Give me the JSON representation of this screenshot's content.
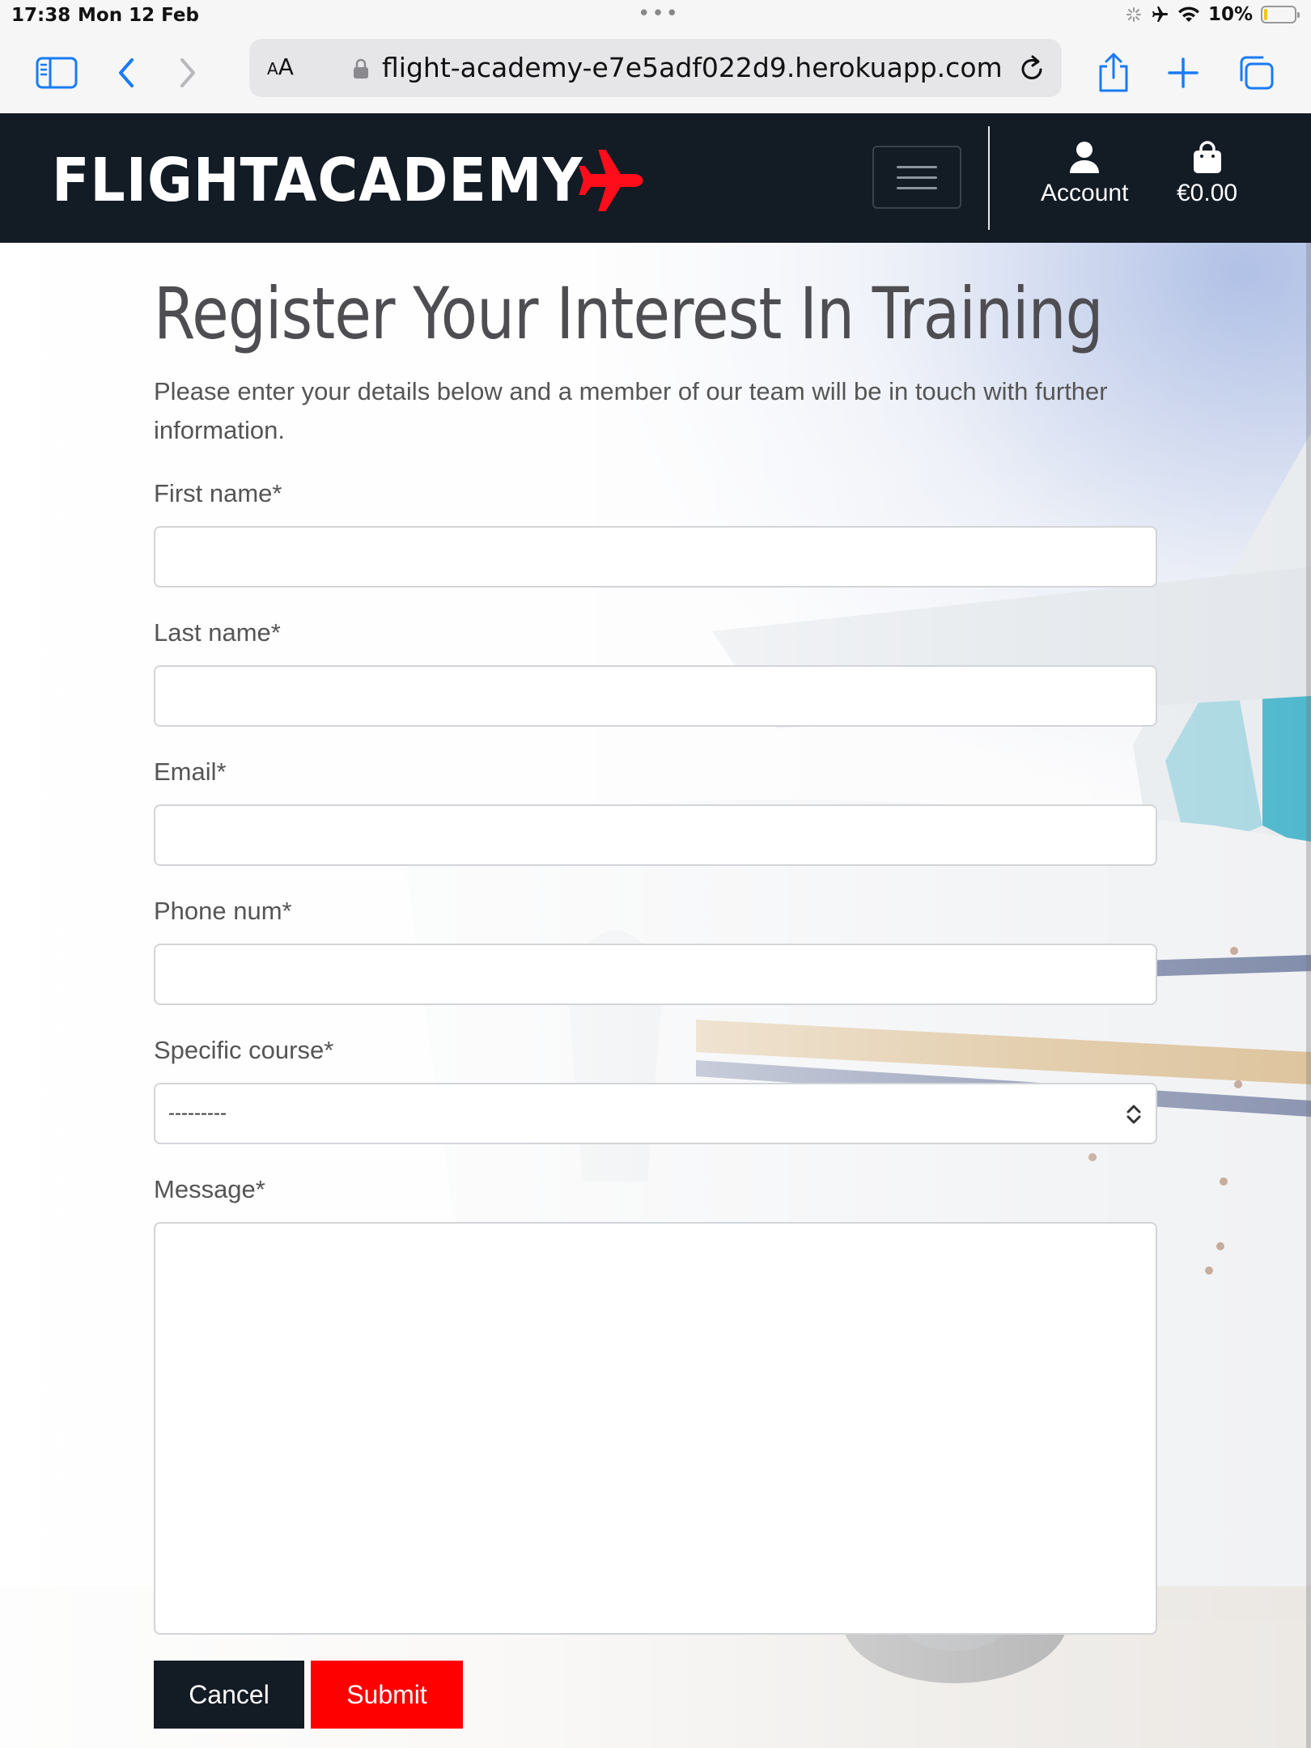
{
  "status_bar": {
    "time": "17:38",
    "date": "Mon 12 Feb",
    "battery": "10%",
    "battery_level": 0.1
  },
  "browser": {
    "text_size_label": "AA",
    "url": "flight-academy-e7e5adf022d9.herokuapp.com",
    "icons": [
      "sidebar-icon",
      "back-icon",
      "forward-icon",
      "lock-icon",
      "reload-icon",
      "share-icon",
      "new-tab-icon",
      "tabs-icon"
    ]
  },
  "header": {
    "logo_text": "FLIGHTACADEMY",
    "logo_icon": "airplane-icon",
    "account_label": "Account",
    "bag_label": "€0.00",
    "brand_color": "#131b25",
    "accent_color": "#ff0000"
  },
  "form": {
    "title": "Register Your Interest In Training",
    "intro": "Please enter your details below and a member of our team will be in touch with further information.",
    "fields": {
      "first_name": {
        "label": "First name*",
        "value": ""
      },
      "last_name": {
        "label": "Last name*",
        "value": ""
      },
      "email": {
        "label": "Email*",
        "value": ""
      },
      "phone": {
        "label": "Phone num*",
        "value": ""
      },
      "course": {
        "label": "Specific course*",
        "selected": "---------"
      },
      "message": {
        "label": "Message*",
        "value": ""
      }
    },
    "cancel_label": "Cancel",
    "submit_label": "Submit"
  }
}
